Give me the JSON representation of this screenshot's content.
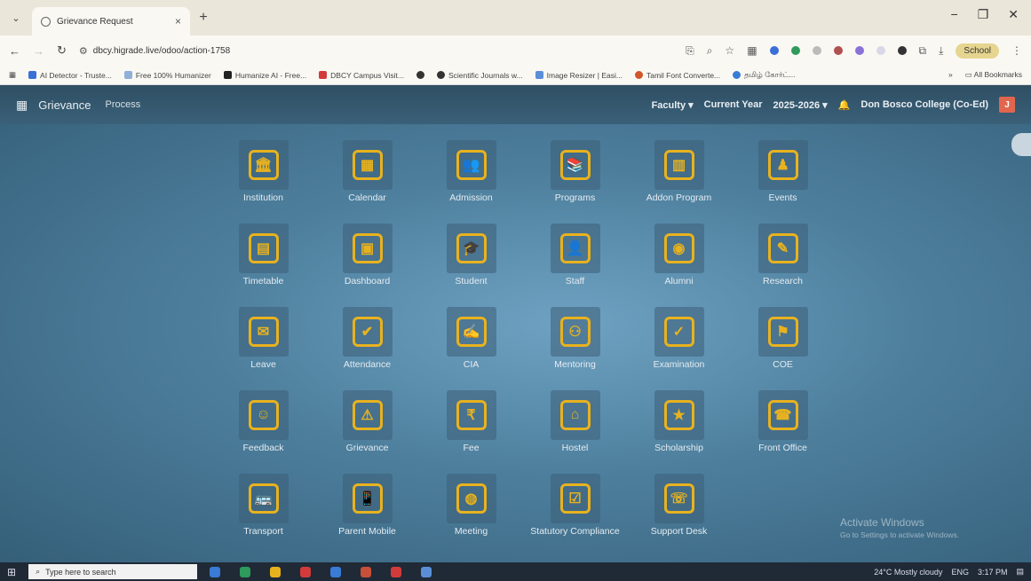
{
  "browser": {
    "tab_title": "Grievance Request",
    "tab_close": "×",
    "new_tab": "+",
    "address": "dbcy.higrade.live/odoo/action-1758",
    "school_label": "School",
    "window": {
      "minimize": "−",
      "restore": "❐",
      "close": "✕"
    }
  },
  "bookmarks": [
    {
      "label": "AI Detector - Truste...",
      "color": "#3b6fd8"
    },
    {
      "label": "Free 100% Humanizer",
      "color": "#8fb0d8"
    },
    {
      "label": "Humanize AI - Free...",
      "color": "#222222"
    },
    {
      "label": "DBCY Campus Visit...",
      "color": "#d33b3b"
    },
    {
      "label": "",
      "color": "#333333"
    },
    {
      "label": "Scientific Journals w...",
      "color": "#333333"
    },
    {
      "label": "Image Resizer | Easi...",
      "color": "#5a8fd8"
    },
    {
      "label": "Tamil Font Converte...",
      "color": "#d0562c"
    },
    {
      "label": "தமிழ் கோர்ட்...",
      "color": "#3a7bd5"
    }
  ],
  "bookmarks_more": "»",
  "bookmarks_all": "All Bookmarks",
  "appbar": {
    "brand": "Grievance",
    "menu": "Process",
    "faculty": "Faculty ▾",
    "current_year_label": "Current Year",
    "year": "2025-2026 ▾",
    "college": "Don Bosco College (Co-Ed)",
    "avatar": "J"
  },
  "tiles": [
    {
      "label": "Institution",
      "icon": "institution-icon",
      "glyph": "🏛"
    },
    {
      "label": "Calendar",
      "icon": "calendar-icon",
      "glyph": "▦"
    },
    {
      "label": "Admission",
      "icon": "admission-icon",
      "glyph": "👥"
    },
    {
      "label": "Programs",
      "icon": "programs-icon",
      "glyph": "📚"
    },
    {
      "label": "Addon Program",
      "icon": "addon-program-icon",
      "glyph": "▥"
    },
    {
      "label": "Events",
      "icon": "events-icon",
      "glyph": "♟"
    },
    {
      "label": "Timetable",
      "icon": "timetable-icon",
      "glyph": "▤"
    },
    {
      "label": "Dashboard",
      "icon": "dashboard-icon",
      "glyph": "▣"
    },
    {
      "label": "Student",
      "icon": "student-icon",
      "glyph": "🎓"
    },
    {
      "label": "Staff",
      "icon": "staff-icon",
      "glyph": "👤"
    },
    {
      "label": "Alumni",
      "icon": "alumni-icon",
      "glyph": "◉"
    },
    {
      "label": "Research",
      "icon": "research-icon",
      "glyph": "✎"
    },
    {
      "label": "Leave",
      "icon": "leave-icon",
      "glyph": "✉"
    },
    {
      "label": "Attendance",
      "icon": "attendance-icon",
      "glyph": "✔"
    },
    {
      "label": "CIA",
      "icon": "cia-icon",
      "glyph": "✍"
    },
    {
      "label": "Mentoring",
      "icon": "mentoring-icon",
      "glyph": "⚇"
    },
    {
      "label": "Examination",
      "icon": "examination-icon",
      "glyph": "✓"
    },
    {
      "label": "COE",
      "icon": "coe-icon",
      "glyph": "⚑"
    },
    {
      "label": "Feedback",
      "icon": "feedback-icon",
      "glyph": "☺"
    },
    {
      "label": "Grievance",
      "icon": "grievance-icon",
      "glyph": "⚠"
    },
    {
      "label": "Fee",
      "icon": "fee-icon",
      "glyph": "₹"
    },
    {
      "label": "Hostel",
      "icon": "hostel-icon",
      "glyph": "⌂"
    },
    {
      "label": "Scholarship",
      "icon": "scholarship-icon",
      "glyph": "★"
    },
    {
      "label": "Front Office",
      "icon": "front-office-icon",
      "glyph": "☎"
    },
    {
      "label": "Transport",
      "icon": "transport-icon",
      "glyph": "🚌"
    },
    {
      "label": "Parent Mobile",
      "icon": "parent-mobile-icon",
      "glyph": "📱"
    },
    {
      "label": "Meeting",
      "icon": "meeting-icon",
      "glyph": "◍"
    },
    {
      "label": "Statutory Compliance",
      "icon": "statutory-compliance-icon",
      "glyph": "☑"
    },
    {
      "label": "Support Desk",
      "icon": "support-desk-icon",
      "glyph": "☏"
    }
  ],
  "watermark": {
    "line1": "Activate Windows",
    "line2": "Go to Settings to activate Windows."
  },
  "taskbar": {
    "search_placeholder": "Type here to search",
    "weather": "24°C Mostly cloudy",
    "lang": "ENG",
    "time": "3:17 PM"
  },
  "colors": {
    "accent": "#e8b21e",
    "appbar": "#2f4f63",
    "avatar": "#e2664e"
  }
}
